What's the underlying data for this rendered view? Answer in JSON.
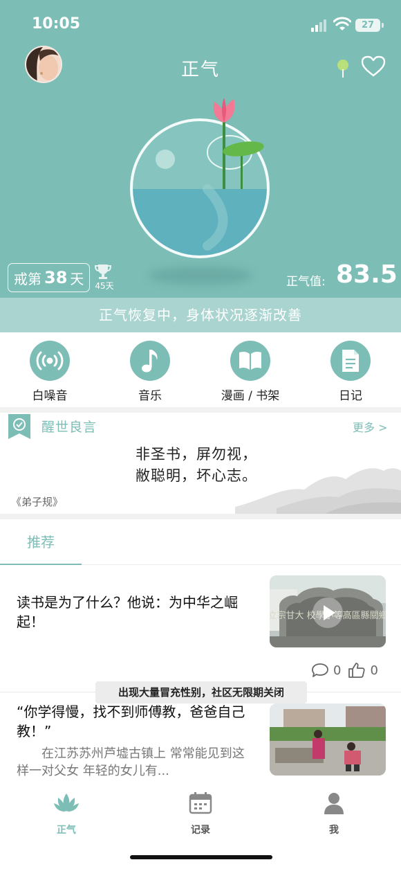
{
  "status_bar": {
    "time": "10:05",
    "battery": "27"
  },
  "header": {
    "title": "正气"
  },
  "stats": {
    "quit_prefix": "戒第",
    "quit_days": "38",
    "quit_suffix": "天",
    "record_days": "45天",
    "zhengqi_label": "正气值:",
    "zhengqi_value": "83.5"
  },
  "status_message": "正气恢复中，身体状况逐渐改善",
  "functions": [
    {
      "label": "白噪音",
      "icon": "radio-waves-icon"
    },
    {
      "label": "音乐",
      "icon": "music-note-icon"
    },
    {
      "label": "漫画 / 书架",
      "icon": "book-icon"
    },
    {
      "label": "日记",
      "icon": "document-icon"
    }
  ],
  "quote": {
    "title": "醒世良言",
    "more": "更多 >",
    "line1": "非圣书，屏勿视，",
    "line2": "敝聪明，坏心志。",
    "source": "《弟子规》"
  },
  "tabs": {
    "active": "推荐"
  },
  "articles": [
    {
      "title": "读书是为了什么？他说：为中华之崛起！",
      "thumb_text": "立宗甘大 校學小等高區縣關鄉",
      "comments": "0",
      "likes": "0"
    },
    {
      "title": "“你学得慢，找不到师傅教，爸爸自己教！”",
      "summary": "在江苏苏州芦墟古镇上        常常能见到这样一对父女        年轻的女儿有..."
    }
  ],
  "toast": "出现大量冒充性别，社区无限期关闭",
  "bottom_nav": [
    {
      "label": "正气",
      "icon": "lotus-icon",
      "active": true
    },
    {
      "label": "记录",
      "icon": "calendar-icon",
      "active": false
    },
    {
      "label": "我",
      "icon": "person-icon",
      "active": false
    }
  ],
  "colors": {
    "accent": "#7cbdb6",
    "strip": "#a9d4d0"
  }
}
